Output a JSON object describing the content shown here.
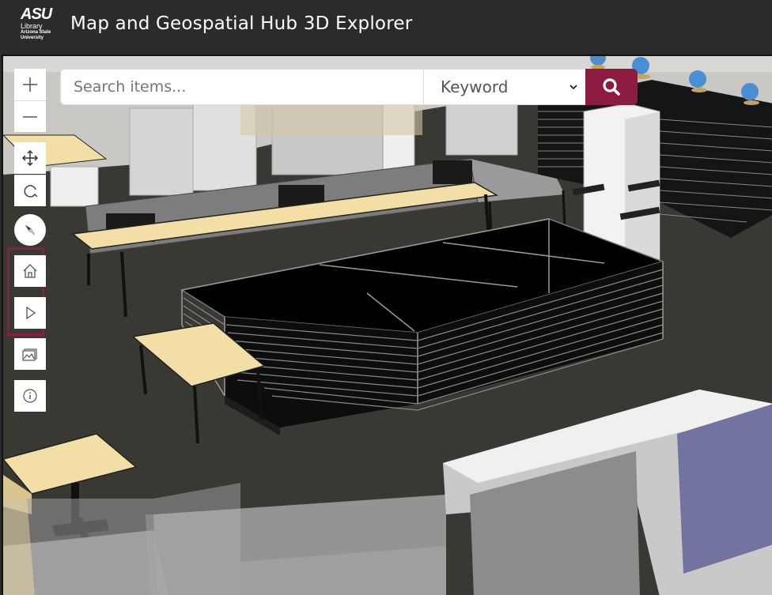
{
  "header": {
    "logo_main": "ASU",
    "logo_library": "Library",
    "logo_university_line1": "Arizona State",
    "logo_university_line2": "University",
    "title": "Map and Geospatial Hub 3D Explorer"
  },
  "search": {
    "placeholder": "Search items...",
    "selected_option": "Keyword",
    "options": [
      "Keyword"
    ]
  },
  "toolbar": {
    "icons": [
      "zoom-in-icon",
      "zoom-out-icon",
      "pan-icon",
      "rotate-icon",
      "compass-icon",
      "home-icon",
      "play-icon",
      "basemap-icon",
      "info-icon"
    ]
  },
  "colors": {
    "brand_maroon": "#8c1d40",
    "header_bg": "#2b2b2b"
  }
}
